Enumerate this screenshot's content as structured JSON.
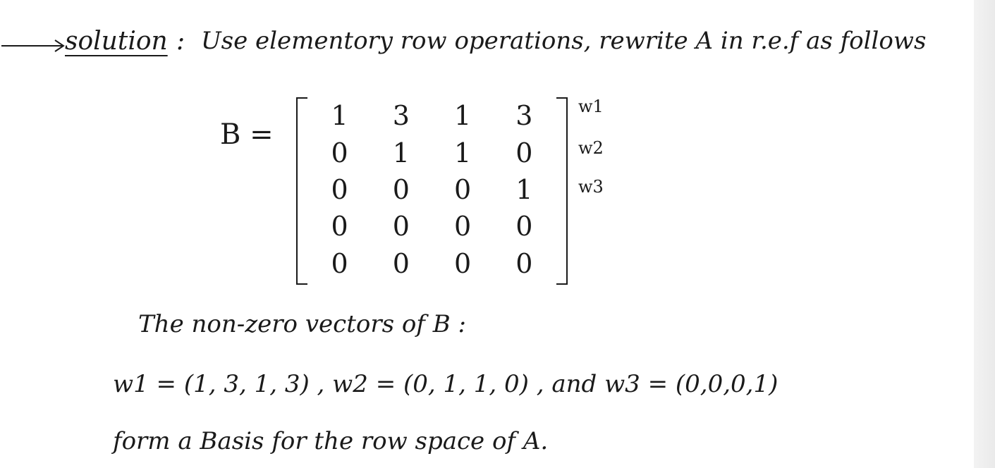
{
  "header": {
    "solution_word": "solution",
    "colon": ":",
    "text": "Use elementory row operations, rewrite A in r.e.f as follows"
  },
  "matrix": {
    "name": "B =",
    "rows": [
      [
        "1",
        "3",
        "1",
        "3"
      ],
      [
        "0",
        "1",
        "1",
        "0"
      ],
      [
        "0",
        "0",
        "0",
        "1"
      ],
      [
        "0",
        "0",
        "0",
        "0"
      ],
      [
        "0",
        "0",
        "0",
        "0"
      ]
    ],
    "row_labels": [
      "w1",
      "w2",
      "w3"
    ]
  },
  "nonzero_text": "The non-zero vectors of B :",
  "vectors_text": "w1 = (1, 3, 1, 3) , w2 = (0, 1, 1, 0) , and w3 = (0,0,0,1)",
  "conclusion_text": "form a Basis for the row space of A."
}
